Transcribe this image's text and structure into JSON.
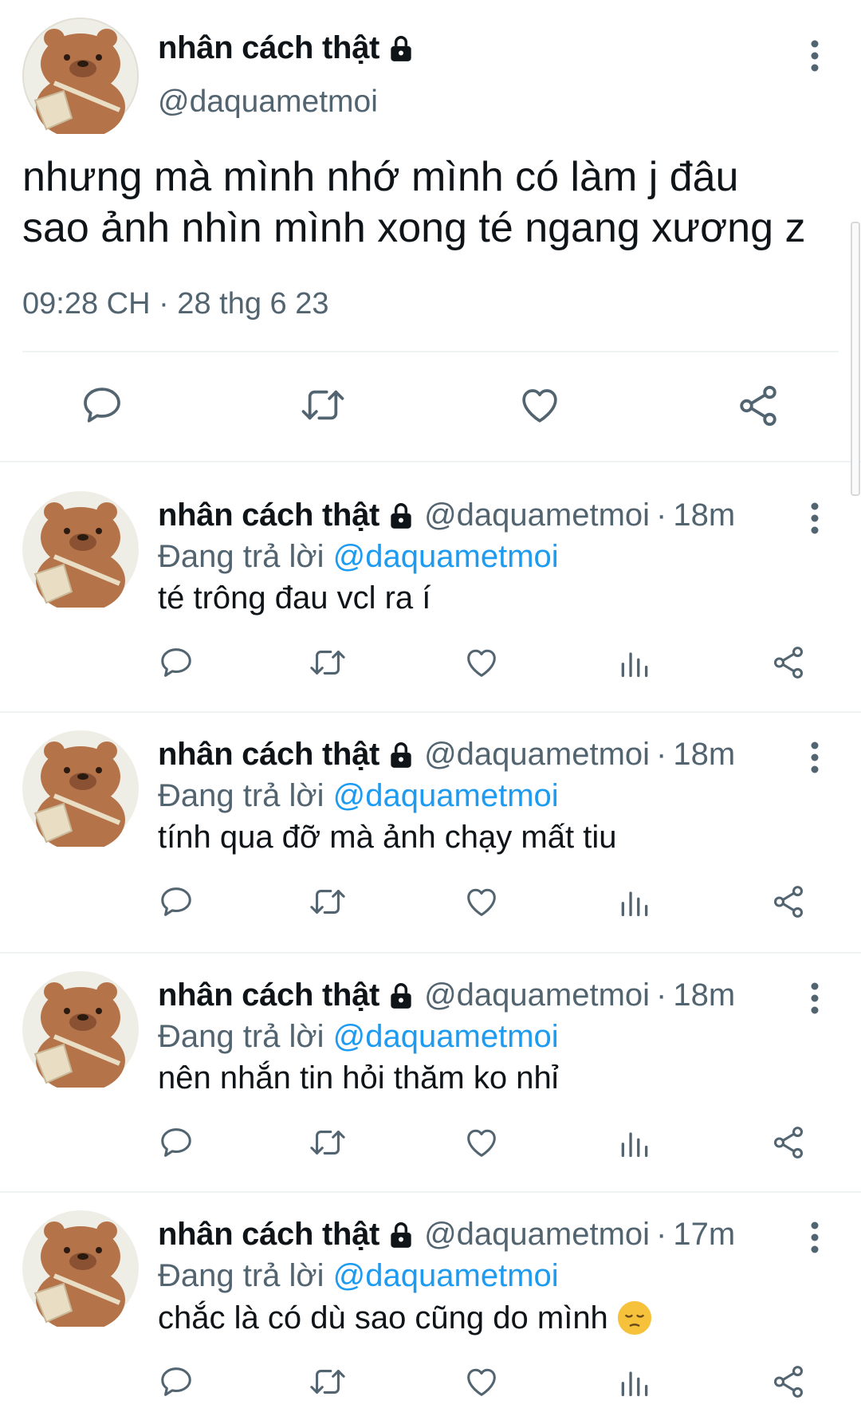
{
  "colors": {
    "text": "#0f1419",
    "muted": "#536471",
    "link": "#1d9bf0",
    "divider": "#eff3f4",
    "avatar_bg": "#efeee6",
    "bear": "#b5734a",
    "bag": "#e9ddc3"
  },
  "main_tweet": {
    "display_name": "nhân cách thật",
    "protected_icon": "lock-icon",
    "handle": "@daquametmoi",
    "text_line1": "nhưng mà mình nhớ mình có làm j đâu",
    "text_line2": "sao ảnh nhìn mình xong té ngang xương z",
    "timestamp": "09:28 CH · 28 thg 6 23",
    "action_icons": [
      "reply-icon",
      "retweet-icon",
      "like-icon",
      "share-icon"
    ]
  },
  "replies": [
    {
      "display_name": "nhân cách thật",
      "handle": "@daquametmoi",
      "separator": "·",
      "time": "18m",
      "replying_prefix": "Đang trả lời",
      "replying_to": "@daquametmoi",
      "text": "té trông đau vcl ra í",
      "emoji": ""
    },
    {
      "display_name": "nhân cách thật",
      "handle": "@daquametmoi",
      "separator": "·",
      "time": "18m",
      "replying_prefix": "Đang trả lời",
      "replying_to": "@daquametmoi",
      "text": "tính qua đỡ mà ảnh chạy mất tiu",
      "emoji": ""
    },
    {
      "display_name": "nhân cách thật",
      "handle": "@daquametmoi",
      "separator": "·",
      "time": "18m",
      "replying_prefix": "Đang trả lời",
      "replying_to": "@daquametmoi",
      "text": "nên nhắn tin hỏi thăm ko nhỉ",
      "emoji": ""
    },
    {
      "display_name": "nhân cách thật",
      "handle": "@daquametmoi",
      "separator": "·",
      "time": "17m",
      "replying_prefix": "Đang trả lời",
      "replying_to": "@daquametmoi",
      "text": "chắc là có dù sao cũng do mình",
      "emoji": "pensive-face-emoji"
    }
  ],
  "reply_action_icons": [
    "reply-icon",
    "retweet-icon",
    "like-icon",
    "views-icon",
    "share-icon"
  ]
}
